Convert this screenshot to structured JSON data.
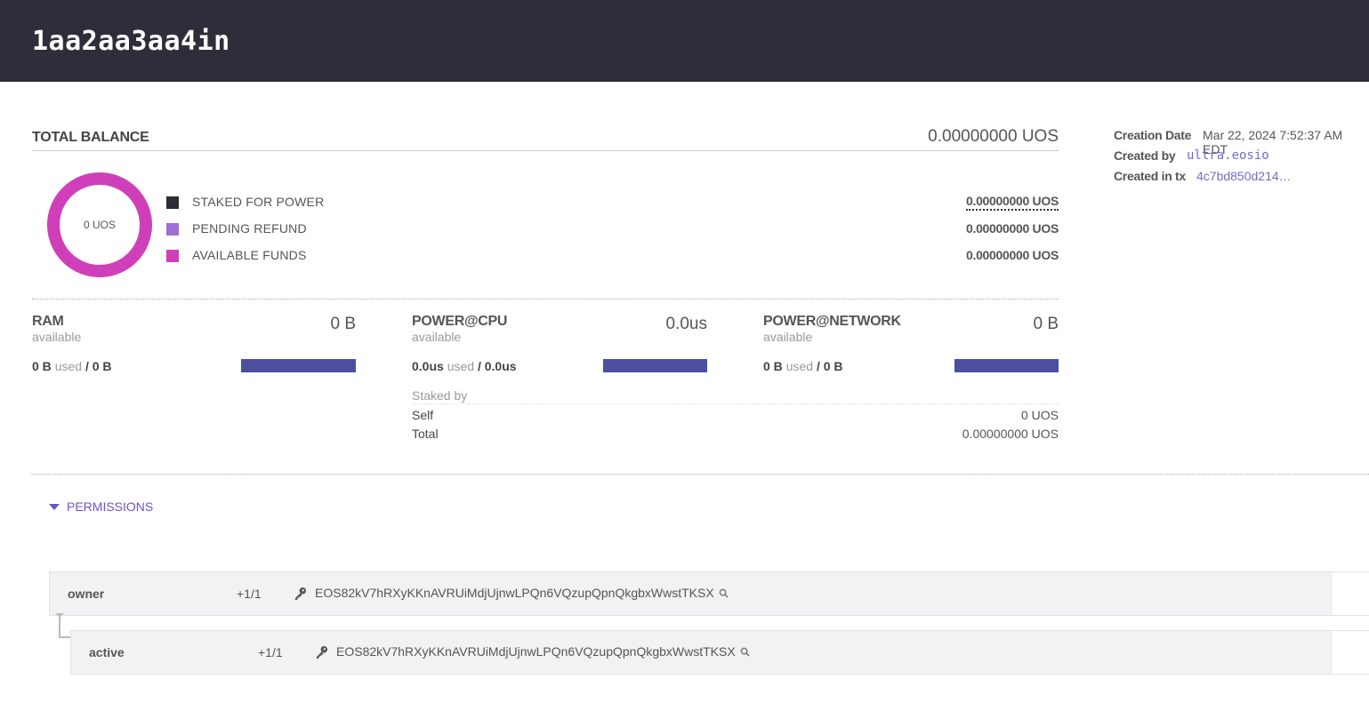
{
  "header": {
    "account_name": "1aa2aa3aa4in"
  },
  "balance": {
    "title": "TOTAL BALANCE",
    "total": "0.00000000 UOS",
    "donut_center": "0 UOS",
    "legend": [
      {
        "label": "STAKED FOR POWER",
        "value": "0.00000000 UOS",
        "color": "#2d2b33"
      },
      {
        "label": "PENDING REFUND",
        "value": "0.00000000 UOS",
        "color": "#a26ed6"
      },
      {
        "label": "AVAILABLE FUNDS",
        "value": "0.00000000 UOS",
        "color": "#d03fba"
      }
    ],
    "donut_color": "#d03fba"
  },
  "resources": {
    "ram": {
      "title": "RAM",
      "sub": "available",
      "amount": "0 B",
      "used": "0 B",
      "used_word": "used",
      "sep": "/",
      "max": "0 B",
      "fill": 1.0
    },
    "cpu": {
      "title": "POWER@CPU",
      "sub": "available",
      "amount": "0.0us",
      "used": "0.0us",
      "used_word": "used",
      "sep": "/",
      "max": "0.0us",
      "fill": 1.0
    },
    "net": {
      "title": "POWER@NETWORK",
      "sub": "available",
      "amount": "0 B",
      "used": "0 B",
      "used_word": "used",
      "sep": "/",
      "max": "0 B",
      "fill": 1.0
    },
    "bar_color": "#4c4e9e"
  },
  "staked_by": {
    "label": "Staked by",
    "rows": [
      {
        "label": "Self",
        "value": "0 UOS"
      },
      {
        "label": "Total",
        "value": "0.00000000 UOS"
      }
    ]
  },
  "info": {
    "creation_date_label": "Creation Date",
    "creation_date": "Mar 22, 2024 7:52:37 AM EDT",
    "created_by_label": "Created by",
    "created_by": "ultra.eosio",
    "created_in_tx_label": "Created in tx",
    "created_in_tx": "4c7bd850d214…"
  },
  "permissions": {
    "toggle_label": "PERMISSIONS",
    "rows": [
      {
        "name": "owner",
        "threshold": "+1/1",
        "key": "EOS82kV7hRXyKKnAVRUiMdjUjnwLPQn6VQzupQpnQkgbxWwstTKSX"
      },
      {
        "name": "active",
        "threshold": "+1/1",
        "key": "EOS82kV7hRXyKKnAVRUiMdjUjnwLPQn6VQzupQpnQkgbxWwstTKSX"
      }
    ]
  }
}
